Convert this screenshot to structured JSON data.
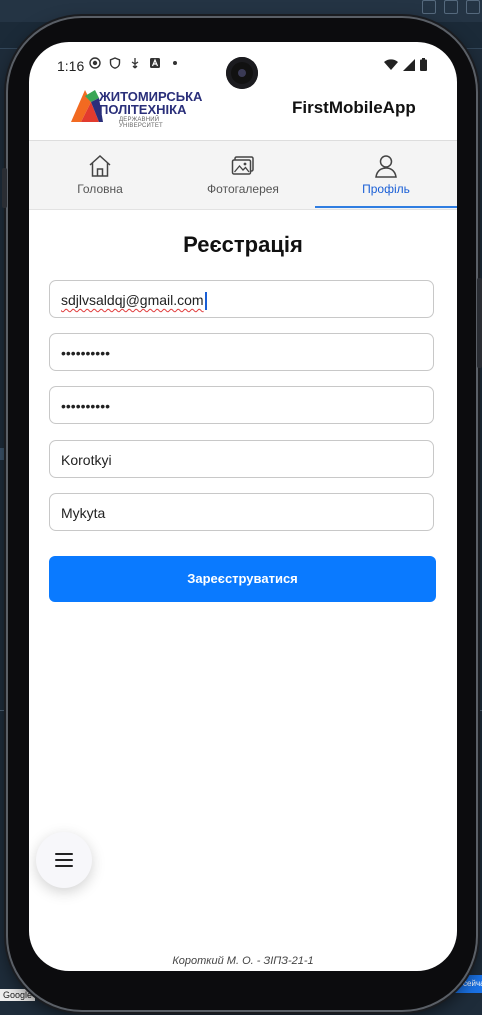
{
  "status_bar": {
    "time": "1:16",
    "left_icons": [
      "record-icon",
      "shield-icon",
      "usb-icon",
      "a-icon",
      "dot-icon"
    ],
    "right_icons": [
      "wifi-icon",
      "signal-icon",
      "battery-icon"
    ]
  },
  "header": {
    "logo": {
      "line1": "ЖИТОМИРСЬКА",
      "line2": "ПОЛІТЕХНІКА",
      "line3": "ДЕРЖАВНИЙ УНІВЕРСИТЕТ"
    },
    "app_title": "FirstMobileApp"
  },
  "tabs": [
    {
      "label": "Головна",
      "icon": "home-icon",
      "active": false
    },
    {
      "label": "Фотогалерея",
      "icon": "gallery-icon",
      "active": false
    },
    {
      "label": "Профіль",
      "icon": "profile-icon",
      "active": true
    }
  ],
  "form": {
    "title": "Реєстрація",
    "email": "sdjlvsaldqj@gmail.com",
    "password": "••••••••••",
    "confirm_password": "••••••••••",
    "last_name": "Korotkyi",
    "first_name": "Mykyta",
    "submit_label": "Зареєструватися"
  },
  "fab": {
    "icon": "menu-icon"
  },
  "footer": {
    "text": "Короткий М. О. - ЗІПЗ-21-1"
  },
  "host": {
    "google_label": "Google",
    "right_chip": "ль сейча"
  },
  "colors": {
    "accent": "#0a7aff",
    "active_tab": "#1a5fd6",
    "logo_blue": "#2a2f7a",
    "logo_orange": "#f26a21",
    "logo_green": "#3aa655"
  }
}
